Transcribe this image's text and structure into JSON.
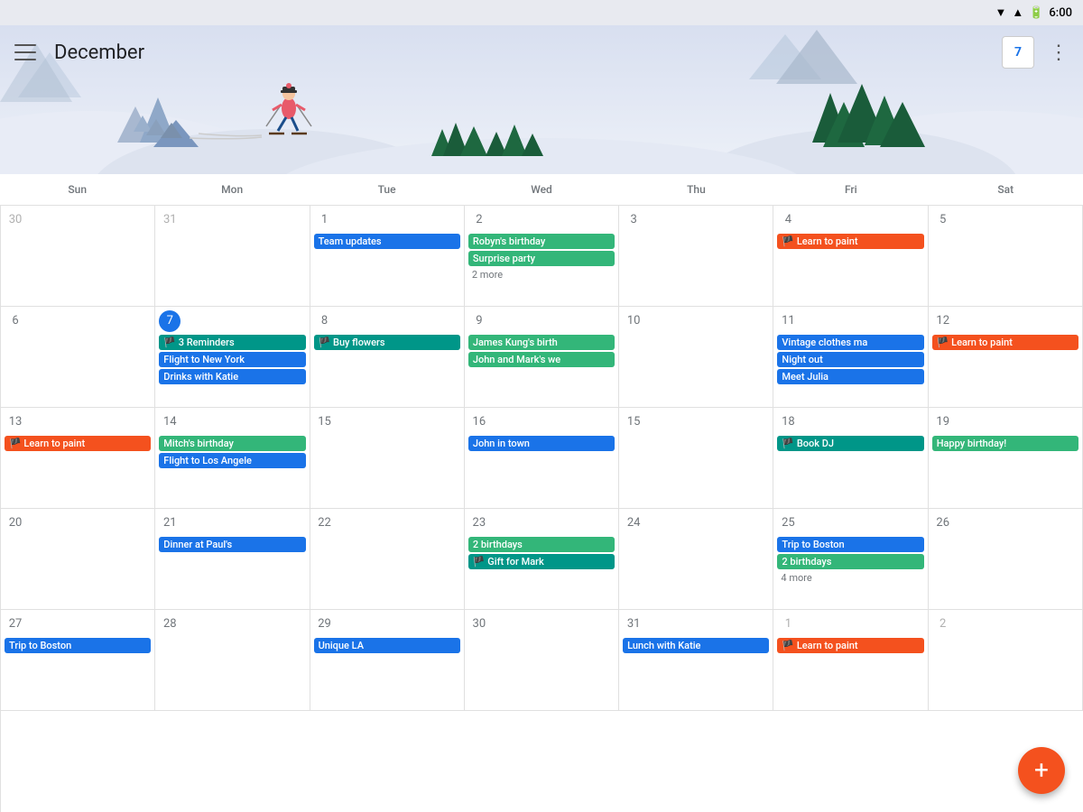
{
  "statusBar": {
    "time": "6:00"
  },
  "header": {
    "menuLabel": "☰",
    "monthTitle": "December",
    "calendarDay": "7",
    "moreIcon": "⋮"
  },
  "dayHeaders": [
    "Sun",
    "Mon",
    "Tue",
    "Wed",
    "Thu",
    "Fri",
    "Sat"
  ],
  "weeks": [
    [
      {
        "date": "30",
        "otherMonth": true,
        "events": []
      },
      {
        "date": "31",
        "otherMonth": true,
        "events": []
      },
      {
        "date": "1",
        "events": [
          {
            "label": "Team updates",
            "color": "blue"
          }
        ]
      },
      {
        "date": "2",
        "events": [
          {
            "label": "Robyn's birthday",
            "color": "green"
          },
          {
            "label": "Surprise party",
            "color": "green"
          }
        ],
        "more": "2 more"
      },
      {
        "date": "3",
        "events": []
      },
      {
        "date": "4",
        "events": [
          {
            "label": "🏴 Learn to paint",
            "color": "orange"
          }
        ]
      },
      {
        "date": "5",
        "events": []
      }
    ],
    [
      {
        "date": "6",
        "events": []
      },
      {
        "date": "7",
        "today": true,
        "events": [
          {
            "label": "🏴 3 Reminders",
            "color": "teal"
          },
          {
            "label": "Flight to New York",
            "color": "blue"
          },
          {
            "label": "Drinks with Katie",
            "color": "blue"
          }
        ]
      },
      {
        "date": "8",
        "events": [
          {
            "label": "🏴 Buy flowers",
            "color": "teal"
          }
        ]
      },
      {
        "date": "9",
        "events": [
          {
            "label": "James Kung's birth",
            "color": "green"
          },
          {
            "label": "John and Mark's we",
            "color": "green"
          }
        ]
      },
      {
        "date": "10",
        "events": []
      },
      {
        "date": "11",
        "events": [
          {
            "label": "Vintage clothes ma",
            "color": "blue"
          },
          {
            "label": "Night out",
            "color": "blue"
          },
          {
            "label": "Meet Julia",
            "color": "blue"
          }
        ]
      },
      {
        "date": "12",
        "events": [
          {
            "label": "🏴 Learn to paint",
            "color": "orange"
          }
        ]
      }
    ],
    [
      {
        "date": "13",
        "events": [
          {
            "label": "🏴 Learn to paint",
            "color": "orange"
          }
        ]
      },
      {
        "date": "14",
        "events": [
          {
            "label": "Mitch's birthday",
            "color": "green"
          },
          {
            "label": "Flight to Los Angele",
            "color": "blue"
          }
        ]
      },
      {
        "date": "15",
        "events": []
      },
      {
        "date": "16",
        "events": [
          {
            "label": "John in town",
            "color": "blue"
          }
        ]
      },
      {
        "date": "15",
        "otherMonth": false,
        "events": []
      },
      {
        "date": "18",
        "events": [
          {
            "label": "🏴 Book DJ",
            "color": "teal"
          }
        ]
      },
      {
        "date": "19",
        "events": [
          {
            "label": "Happy birthday!",
            "color": "green"
          }
        ]
      }
    ],
    [
      {
        "date": "20",
        "events": []
      },
      {
        "date": "21",
        "events": [
          {
            "label": "Dinner at Paul's",
            "color": "blue"
          }
        ]
      },
      {
        "date": "22",
        "events": []
      },
      {
        "date": "23",
        "events": [
          {
            "label": "2 birthdays",
            "color": "green"
          },
          {
            "label": "🏴 Gift for Mark",
            "color": "teal"
          }
        ]
      },
      {
        "date": "24",
        "events": []
      },
      {
        "date": "25",
        "events": [
          {
            "label": "Trip to Boston",
            "color": "blue"
          },
          {
            "label": "2 birthdays",
            "color": "green"
          }
        ],
        "more": "4 more"
      },
      {
        "date": "26",
        "events": []
      }
    ],
    [
      {
        "date": "27",
        "events": [
          {
            "label": "Trip to Boston",
            "color": "blue"
          }
        ]
      },
      {
        "date": "28",
        "events": []
      },
      {
        "date": "29",
        "events": [
          {
            "label": "Unique LA",
            "color": "blue"
          }
        ]
      },
      {
        "date": "30",
        "events": []
      },
      {
        "date": "31",
        "events": [
          {
            "label": "Lunch with Katie",
            "color": "blue"
          }
        ]
      },
      {
        "date": "1",
        "otherMonth": true,
        "events": [
          {
            "label": "🏴 Learn to paint",
            "color": "orange"
          }
        ]
      },
      {
        "date": "2",
        "otherMonth": true,
        "events": []
      }
    ]
  ],
  "fab": {
    "label": "+"
  }
}
